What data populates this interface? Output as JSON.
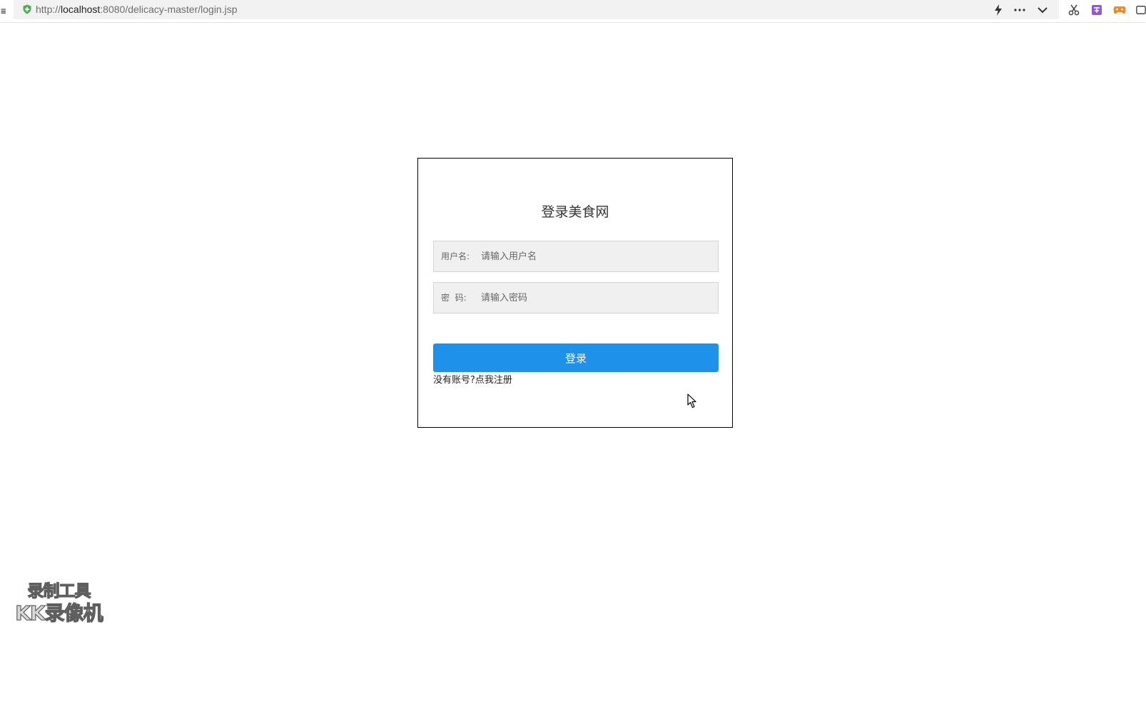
{
  "browser": {
    "url_prefix": "http://",
    "url_host": "localhost",
    "url_rest": ":8080/delicacy-master/login.jsp",
    "icons": [
      "secure-shield-icon",
      "lightning-icon",
      "more-icon",
      "chevron-down-icon",
      "scissors-icon",
      "translate-icon",
      "game-icon",
      "extension-icon"
    ]
  },
  "login": {
    "title": "登录美食网",
    "username_label": "用户名:",
    "username_placeholder": "请输入用户名",
    "password_label": "密  码:",
    "password_placeholder": "请输入密码",
    "submit_label": "登录",
    "register_prompt": "没有账号?",
    "register_link": "点我注册"
  },
  "watermark": {
    "line1": "录制工具",
    "line2": "KK录像机"
  },
  "colors": {
    "button": "#1e91eb",
    "field_bg": "#f0f0f0",
    "card_border": "#000000",
    "secure": "#4caf50"
  }
}
